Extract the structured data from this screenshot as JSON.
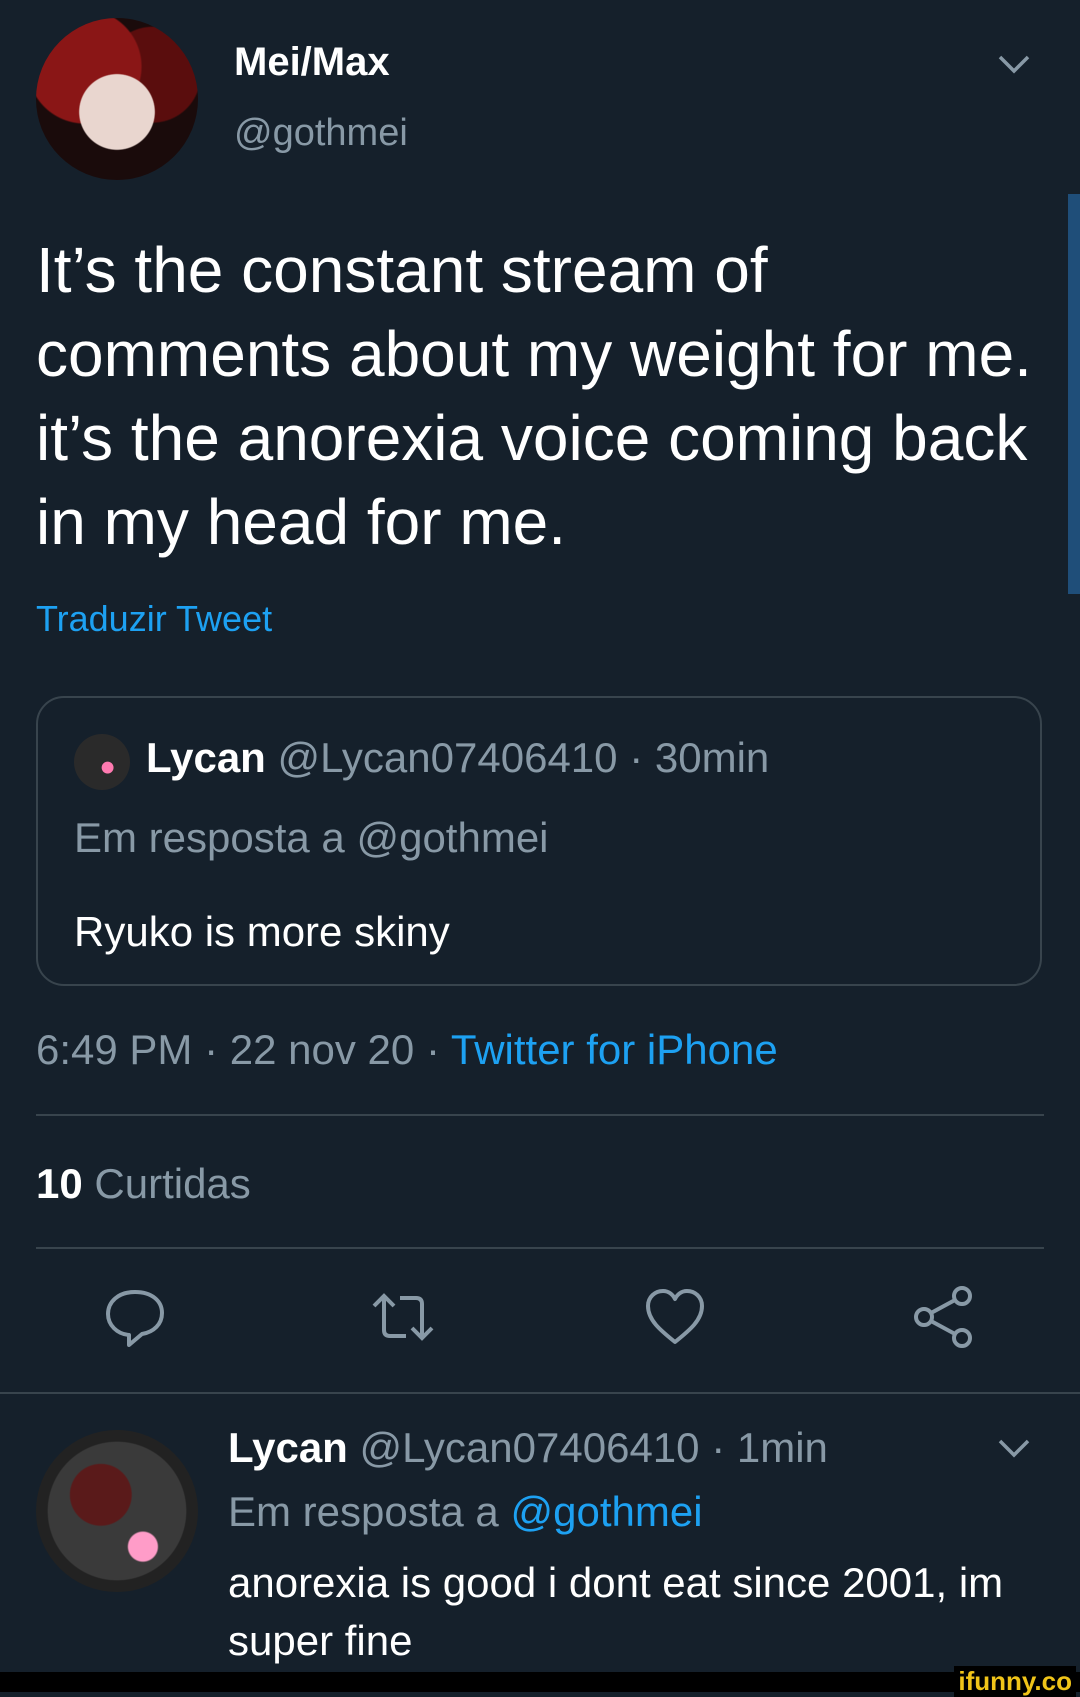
{
  "tweet": {
    "name": "Mei/Max",
    "handle": "@gothmei",
    "text": "It’s the constant stream of comments about my weight for me. it’s the anorexia voice coming back in my head for me.",
    "translate": "Traduzir Tweet",
    "quote": {
      "name": "Lycan",
      "handle": "@Lycan07406410",
      "sep": "·",
      "time": "30min",
      "reply_to": "Em resposta a @gothmei",
      "text": "Ryuko is more skiny"
    },
    "meta": {
      "time": "6:49 PM",
      "sep1": "·",
      "date": "22 nov 20",
      "sep2": "·",
      "source": "Twitter for iPhone"
    },
    "likes": {
      "count": "10",
      "label": "Curtidas"
    }
  },
  "icons": {
    "reply": "reply-icon",
    "retweet": "retweet-icon",
    "like": "heart-icon",
    "share": "share-icon",
    "menu": "chevron-down-icon"
  },
  "reply": {
    "name": "Lycan",
    "handle": "@Lycan07406410",
    "sep": "·",
    "time": "1min",
    "reply_prefix": "Em resposta a",
    "reply_link": "@gothmei",
    "text": "anorexia is good i dont eat since 2001, im super fine"
  },
  "watermark": "ifunny.co",
  "colors": {
    "background": "#15202b",
    "link": "#1da1f2",
    "muted": "#8899a6",
    "divider": "#38444d"
  }
}
